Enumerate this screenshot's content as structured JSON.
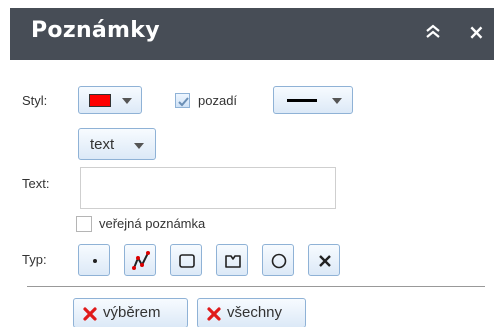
{
  "panel": {
    "title": "Poznámky",
    "close_symbol": "×"
  },
  "style": {
    "label": "Styl:",
    "color": "#ff0000",
    "background_label": "pozadí",
    "background_checked": true
  },
  "text_mode": {
    "label": "text"
  },
  "text_field": {
    "label": "Text:",
    "value": ""
  },
  "public_note": {
    "label": "veřejná poznámka",
    "checked": false
  },
  "type": {
    "label": "Typ:",
    "tools": [
      "point-icon",
      "polyline-icon",
      "rectangle-icon",
      "polygon-icon",
      "circle-icon",
      "delete-icon"
    ]
  },
  "delete": {
    "selection_label": "výběrem",
    "all_label": "všechny"
  }
}
